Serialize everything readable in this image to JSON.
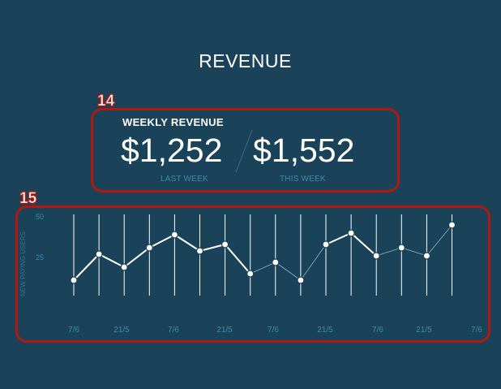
{
  "page": {
    "title": "REVENUE"
  },
  "callouts": {
    "revenue": "14",
    "chart": "15"
  },
  "weekly_revenue": {
    "heading": "WEEKLY REVENUE",
    "last_week": {
      "amount": "$1,252",
      "label": "LAST WEEK"
    },
    "this_week": {
      "amount": "$1,552",
      "label": "THIS WEEK"
    }
  },
  "colors": {
    "background": "#1a4359",
    "callout": "#b4170f",
    "muted_text": "#3d8aab"
  },
  "chart_data": {
    "type": "line",
    "ylabel": "NEW PAYING USERS",
    "ylim": [
      0,
      50
    ],
    "yticks": [
      50,
      25
    ],
    "xtick_labels": [
      "7/6",
      "21/5",
      "7/6",
      "21/5",
      "7/6",
      "21/5",
      "7/6",
      "21/5",
      "7/6"
    ],
    "series": [
      {
        "values": [
          11,
          27,
          19,
          31,
          39,
          29,
          33,
          15,
          22,
          11,
          33,
          40,
          26,
          31,
          26,
          45
        ],
        "segments_highlighted": [
          true,
          true,
          true,
          true,
          true,
          true,
          true,
          false,
          false,
          false,
          true,
          true,
          false,
          false,
          false,
          false
        ]
      }
    ],
    "grid": "vertical-lines"
  }
}
